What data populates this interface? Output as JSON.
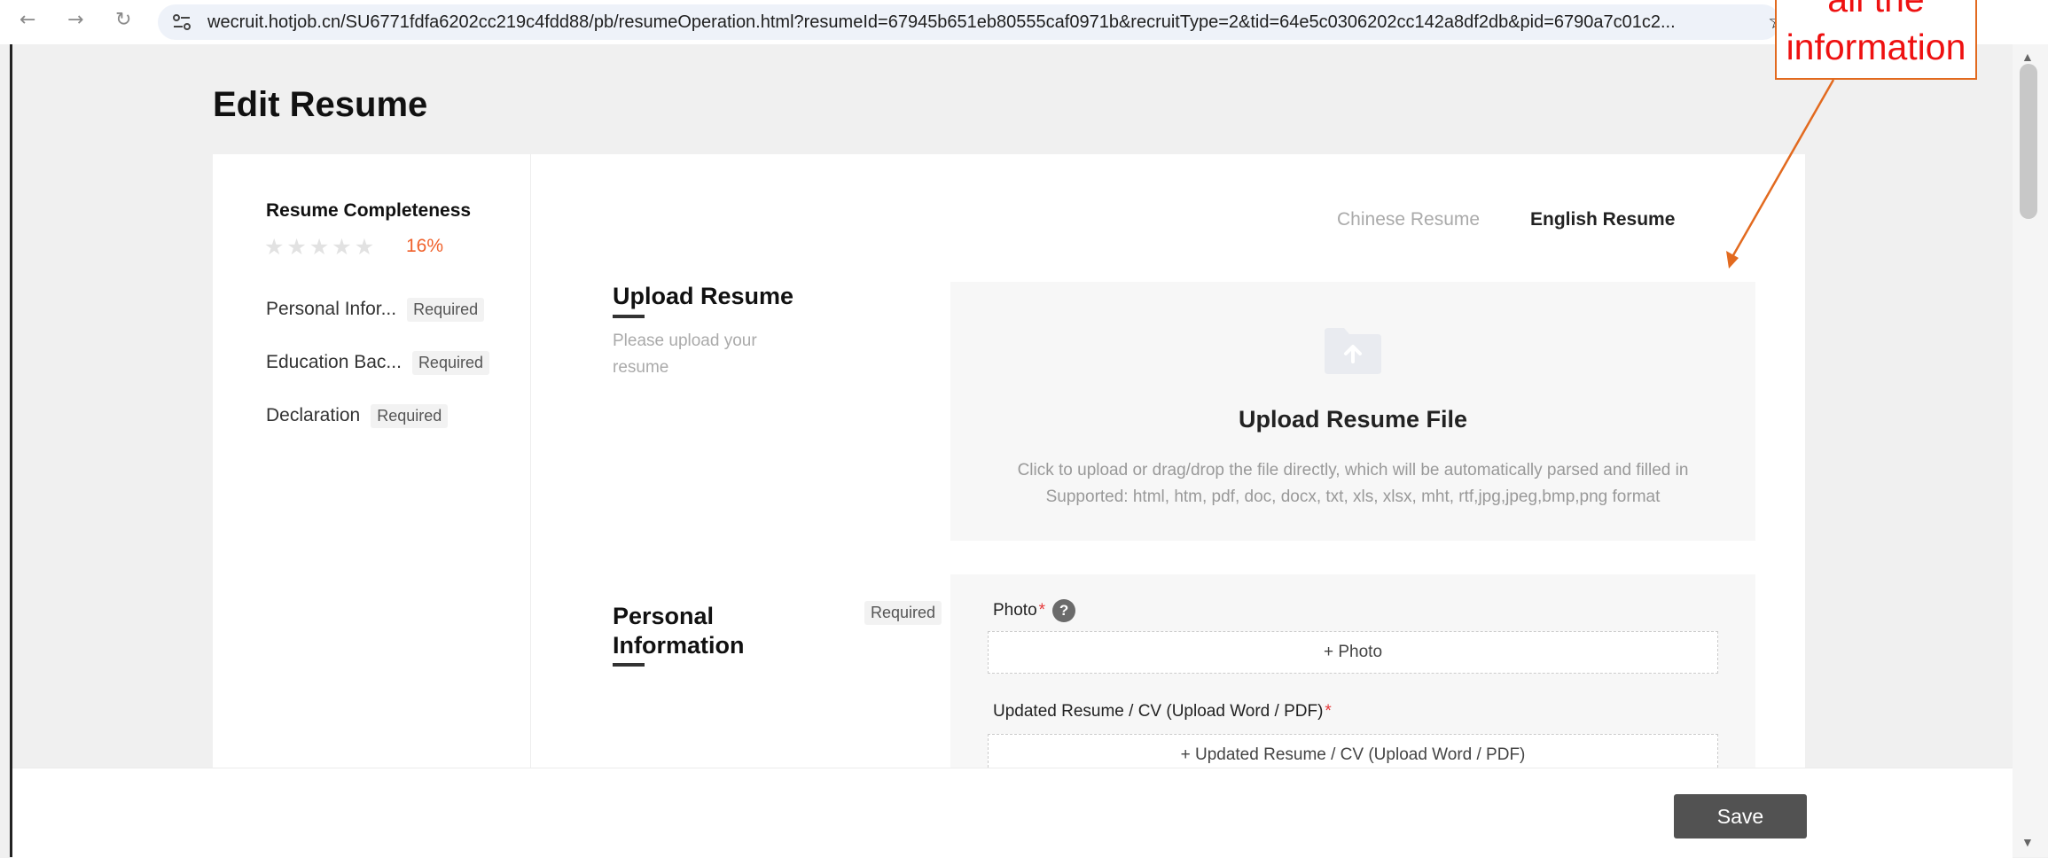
{
  "browser": {
    "url": "wecruit.hotjob.cn/SU6771fdfa6202cc219c4fdd88/pb/resumeOperation.html?resumeId=67945b651eb80555caf0971b&recruitType=2&tid=64e5c0306202cc142a8df2db&pid=6790a7c01c2...",
    "icons": [
      "back-arrow-icon",
      "forward-arrow-icon",
      "reload-icon",
      "site-settings-icon",
      "bookmark-star-icon"
    ]
  },
  "page": {
    "title": "Edit Resume"
  },
  "sidebar": {
    "completeness_label": "Resume Completeness",
    "stars_filled": 0,
    "stars_total": 5,
    "percent": "16%",
    "items": [
      {
        "label": "Personal Infor...",
        "badge": "Required"
      },
      {
        "label": "Education Bac...",
        "badge": "Required"
      },
      {
        "label": "Declaration",
        "badge": "Required"
      }
    ]
  },
  "lang_tabs": {
    "chinese": "Chinese Resume",
    "english": "English Resume",
    "active": "english"
  },
  "upload": {
    "title": "Upload Resume",
    "desc": "Please upload your resume",
    "zone_title": "Upload Resume File",
    "zone_line1": "Click to upload or drag/drop the file directly, which will be automatically parsed and filled in",
    "zone_line2": "Supported: html, htm, pdf, doc, docx, txt, xls, xlsx, mht, rtf,jpg,jpeg,bmp,png format"
  },
  "personal": {
    "title_line1": "Personal",
    "title_line2": "Information",
    "badge": "Required",
    "fields": [
      {
        "label": "Photo",
        "required_mark": "*",
        "button": "+ Photo"
      },
      {
        "label": "Updated Resume / CV (Upload Word / PDF)",
        "required_mark": "*",
        "button": "+ Updated Resume / CV (Upload Word / PDF)"
      }
    ]
  },
  "footer": {
    "save": "Save"
  },
  "annotation": {
    "line1": "all the",
    "line2": "information"
  },
  "colors": {
    "accent": "#f0612b",
    "required": "#e5393a",
    "annotation_text": "#ee1111",
    "annotation_border": "#e26a1f",
    "save_button": "#525252"
  }
}
